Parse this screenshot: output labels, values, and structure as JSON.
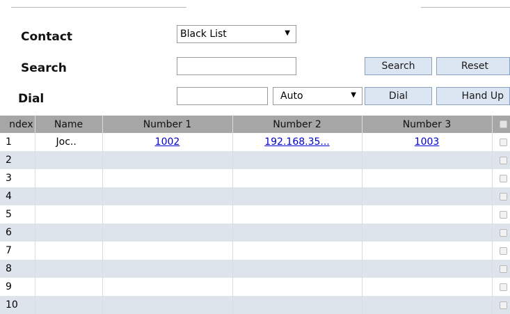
{
  "contact": {
    "label": "Contact",
    "selected": "Black List"
  },
  "search": {
    "label": "Search",
    "value": "",
    "search_button": "Search",
    "reset_button": "Reset"
  },
  "dial": {
    "label": "Dial",
    "value": "",
    "mode": "Auto",
    "dial_button": "Dial",
    "hangup_button": "Hand Up"
  },
  "table": {
    "columns": [
      "ndex",
      "Name",
      "Number 1",
      "Number 2",
      "Number 3"
    ],
    "rows": [
      {
        "index": "1",
        "name": "Joc..",
        "number1": "1002",
        "number2": "192.168.35...",
        "number3": "1003"
      },
      {
        "index": "2",
        "name": "",
        "number1": "",
        "number2": "",
        "number3": ""
      },
      {
        "index": "3",
        "name": "",
        "number1": "",
        "number2": "",
        "number3": ""
      },
      {
        "index": "4",
        "name": "",
        "number1": "",
        "number2": "",
        "number3": ""
      },
      {
        "index": "5",
        "name": "",
        "number1": "",
        "number2": "",
        "number3": ""
      },
      {
        "index": "6",
        "name": "",
        "number1": "",
        "number2": "",
        "number3": ""
      },
      {
        "index": "7",
        "name": "",
        "number1": "",
        "number2": "",
        "number3": ""
      },
      {
        "index": "8",
        "name": "",
        "number1": "",
        "number2": "",
        "number3": ""
      },
      {
        "index": "9",
        "name": "",
        "number1": "",
        "number2": "",
        "number3": ""
      },
      {
        "index": "10",
        "name": "",
        "number1": "",
        "number2": "",
        "number3": ""
      }
    ]
  },
  "colors": {
    "header_bg": "#a6a6a6",
    "alt_row_bg": "#dde4ec",
    "button_bg": "#dce6f3",
    "link": "#0000cc"
  }
}
